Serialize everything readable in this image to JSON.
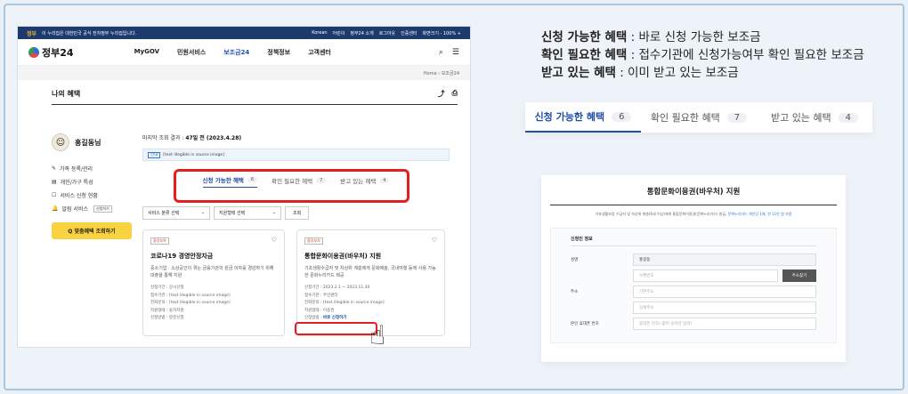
{
  "notice": {
    "emblem": "정부",
    "text": "이 누리집은 대한민국 공식 전자정부 누리집입니다.",
    "links": [
      "Korean",
      "어린이",
      "정부24 소개",
      "로그아웃",
      "인증센터",
      "화면크기 - 100% +"
    ]
  },
  "header": {
    "logo": "정부24",
    "nav": [
      "MyGOV",
      "민원서비스",
      "보조금24",
      "정책정보",
      "고객센터"
    ],
    "search_icon": "⌕",
    "menu_icon": "☰"
  },
  "breadcrumb": "Home › 보조금24",
  "page": {
    "title": "나의 혜택",
    "share_icon": "⤴",
    "print_icon": "⎙"
  },
  "user": {
    "name": "홍길동님",
    "avatar": "☺"
  },
  "side_menu": [
    {
      "icon": "✎",
      "label": "가족 등록/관리",
      "tag": ""
    },
    {
      "icon": "▤",
      "label": "개인/가구 특성",
      "tag": ""
    },
    {
      "icon": "☐",
      "label": "서비스 신청 현황",
      "tag": ""
    },
    {
      "icon": "🔔",
      "label": "알림 서비스",
      "tag": "신청하기"
    }
  ],
  "side_button": "Q 맞춤혜택 조회하기",
  "main": {
    "last_query_label": "마지막 조회 결과 :",
    "last_query_value": "47일 전 (2023.4.28)",
    "info_label": "안내",
    "info_text": "[text illegible in source image]",
    "tabs": [
      {
        "label": "신청 가능한 혜택",
        "count": "6"
      },
      {
        "label": "확인 필요한 혜택",
        "count": "7"
      },
      {
        "label": "받고 있는 혜택",
        "count": "4"
      }
    ],
    "filter1": "서비스 분류 선택",
    "filter2": "지원형태 선택",
    "query_button": "조회"
  },
  "cards": [
    {
      "chip": "중앙부처",
      "title": "코로나19 경영안정자금",
      "desc": "중소기업 · 소상공인이 겪는 금융기관의 원금 이자를 경감하기 위해 대출을 통해 지원",
      "rows": [
        "신청기간 : 상시신청",
        "접수기관 : [text illegible in source image]",
        "전화문의 : [text illegible in source image]",
        "지원형태 : 융자지원",
        "신청방법 : 방문신청"
      ],
      "highlight": ""
    },
    {
      "chip": "중앙부처",
      "title": "통합문화이용권(바우처) 지원",
      "desc": "기초생활수급자 및 차상위 계층에게 문화예술, 국내여행 등에 사용 가능한 문화누리카드 제공",
      "rows": [
        "신청기간 : 2023.2.1 ~ 2023.11.30",
        "접수기관 : 주민센터",
        "전화문의 : [text illegible in source image]",
        "지원형태 : 이용권"
      ],
      "highlight_label": "신청방법 :",
      "highlight": "바로 신청하기"
    }
  ],
  "captions": [
    {
      "bold": "신청 가능한 혜택",
      "rest": " : 바로 신청 가능한 보조금"
    },
    {
      "bold": "확인 필요한 혜택",
      "rest": " : 접수기관에 신청가능여부 확인 필요한 보조금"
    },
    {
      "bold": "받고 있는 혜택",
      "rest": " : 이미 받고 있는 보조금"
    }
  ],
  "zoom_tabs": [
    {
      "label": "신청 가능한 혜택",
      "count": "6"
    },
    {
      "label": "확인 필요한 혜택",
      "count": "7"
    },
    {
      "label": "받고 있는 혜택",
      "count": "4"
    }
  ],
  "form": {
    "title": "통합문화이용권(바우처) 지원",
    "desc_a": "기초생활보장 수급자 및 차상위 계층(6세 이상)에게 통합문화이용권(문화누리카드) 발급,",
    "desc_b": " 문화누리카드 개인당 1매, 연 11만 원 지원",
    "section": "신청인 정보",
    "rows": [
      {
        "label": "성명",
        "value": "홍길동",
        "filled": true,
        "button": ""
      },
      {
        "label": "",
        "value": "우편번호",
        "filled": false,
        "button": "주소찾기"
      },
      {
        "label": "주소",
        "value": "기본주소",
        "filled": false,
        "button": ""
      },
      {
        "label": "",
        "value": "상세주소",
        "filled": false,
        "button": ""
      },
      {
        "label": "본인 휴대폰 번호",
        "value": "휴대폰 번호(-없이 숫자만 입력)",
        "filled": false,
        "button": ""
      }
    ]
  }
}
